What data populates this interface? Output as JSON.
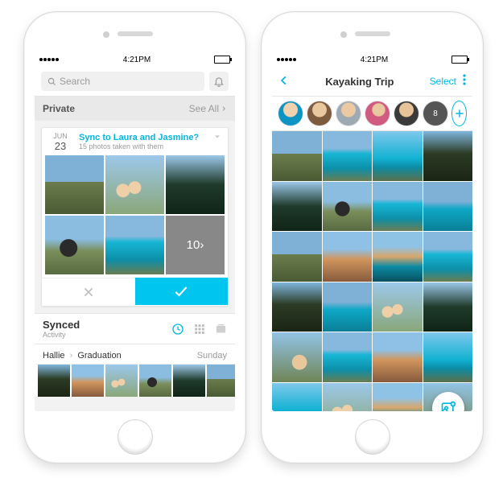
{
  "status": {
    "time": "4:21PM"
  },
  "left": {
    "search": {
      "placeholder": "Search"
    },
    "private": {
      "title": "Private",
      "see_all": "See All"
    },
    "card": {
      "date_month": "JUN",
      "date_day": "23",
      "prompt_title": "Sync to Laura and Jasmine?",
      "prompt_sub": "15 photos taken with them",
      "more_count": "10"
    },
    "synced": {
      "title": "Synced",
      "sub": "Activity",
      "row_left": "Hallie",
      "row_right": "Graduation",
      "row_time": "Sunday"
    }
  },
  "right": {
    "nav": {
      "title": "Kayaking Trip",
      "select": "Select"
    },
    "avatars": {
      "overflow_badge": "8"
    }
  }
}
